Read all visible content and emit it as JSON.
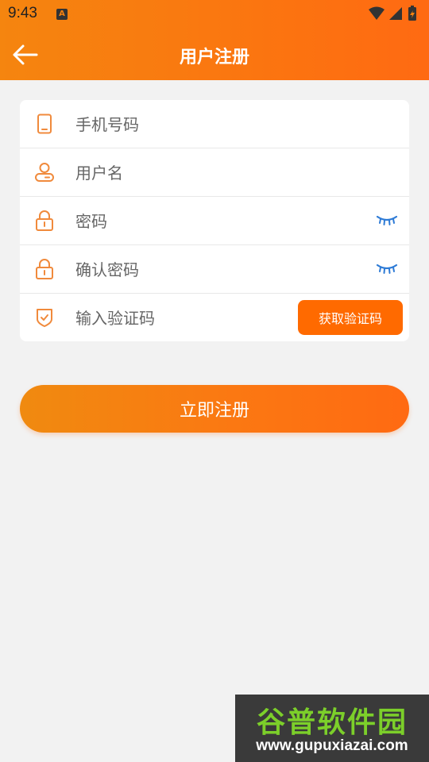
{
  "status_bar": {
    "time": "9:43",
    "notification_badge": "A"
  },
  "header": {
    "title": "用户注册",
    "gradient_from": "#f5850f",
    "gradient_to": "#ff6a12"
  },
  "form": {
    "fields": [
      {
        "icon": "phone-icon",
        "placeholder": "手机号码"
      },
      {
        "icon": "user-icon",
        "placeholder": "用户名"
      },
      {
        "icon": "lock-icon",
        "placeholder": "密码"
      },
      {
        "icon": "lock-icon",
        "placeholder": "确认密码"
      },
      {
        "icon": "shield-icon",
        "placeholder": "输入验证码"
      }
    ],
    "get_code_label": "获取验证码"
  },
  "actions": {
    "register_label": "立即注册"
  },
  "watermark": {
    "title": "谷普软件园",
    "url": "www.gupuxiazai.com"
  },
  "colors": {
    "accent": "#ff6a00",
    "icon": "#f08a3c",
    "eye": "#2e7bd6",
    "background": "#f2f2f2"
  }
}
